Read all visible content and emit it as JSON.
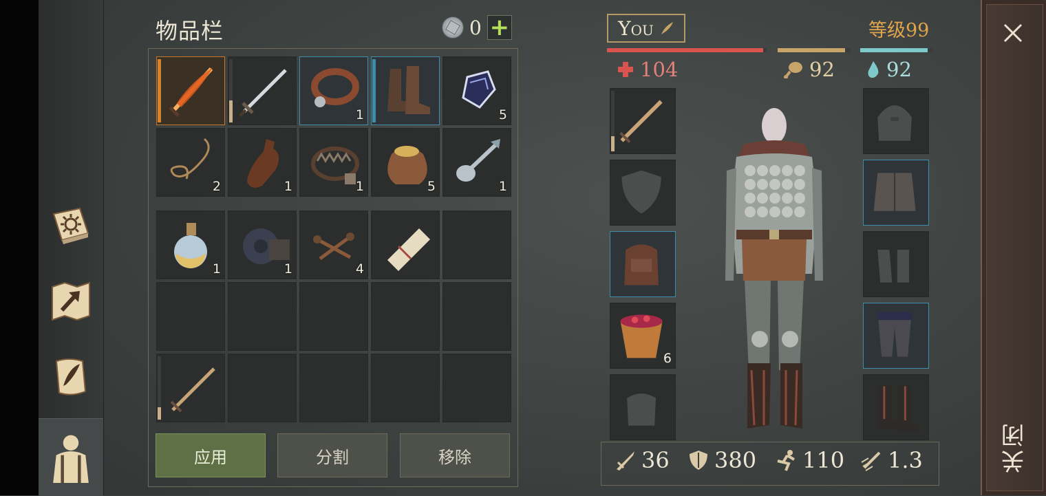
{
  "inventory": {
    "title": "物品栏",
    "currency": "0",
    "row1": [
      {
        "name": "flaming-sword-icon",
        "qty": "",
        "durability": 1.0,
        "dur_color": "#d4832c",
        "highlight": "orange"
      },
      {
        "name": "longsword-icon",
        "qty": "",
        "durability": 0.35,
        "dur_color": "#c9b08a",
        "highlight": ""
      },
      {
        "name": "leather-collar-icon",
        "qty": "1",
        "highlight": "blue"
      },
      {
        "name": "leather-boots-icon",
        "qty": "",
        "durability": 1.0,
        "dur_color": "#3f8ea9",
        "highlight": "blue"
      },
      {
        "name": "dark-crystal-icon",
        "qty": "5",
        "highlight": ""
      }
    ],
    "row2": [
      {
        "name": "rope-icon",
        "qty": "2"
      },
      {
        "name": "leather-flask-icon",
        "qty": "1"
      },
      {
        "name": "bear-trap-icon",
        "qty": "1"
      },
      {
        "name": "grain-sack-icon",
        "qty": "5"
      },
      {
        "name": "spoon-icon",
        "qty": "1"
      }
    ],
    "backpack": [
      {
        "name": "potion-flask-icon",
        "qty": "1"
      },
      {
        "name": "gear-cog-icon",
        "qty": "1"
      },
      {
        "name": "nails-icon",
        "qty": "4"
      },
      {
        "name": "scroll-icon",
        "qty": ""
      },
      {
        "name": "empty-slot",
        "qty": ""
      },
      {
        "name": "empty-slot",
        "qty": ""
      },
      {
        "name": "empty-slot",
        "qty": ""
      },
      {
        "name": "empty-slot",
        "qty": ""
      },
      {
        "name": "empty-slot",
        "qty": ""
      },
      {
        "name": "empty-slot",
        "qty": ""
      },
      {
        "name": "wooden-sword-icon",
        "qty": "",
        "durability": 0.2,
        "dur_color": "#c9b08a"
      },
      {
        "name": "empty-slot",
        "qty": ""
      },
      {
        "name": "empty-slot",
        "qty": ""
      },
      {
        "name": "empty-slot",
        "qty": ""
      },
      {
        "name": "empty-slot",
        "qty": ""
      }
    ],
    "buttons": {
      "apply": "应用",
      "split": "分割",
      "remove": "移除"
    }
  },
  "character": {
    "name": "You",
    "level": "等级99",
    "health": "104",
    "hunger": "92",
    "thirst": "92",
    "health_fraction": 0.98,
    "hunger_fraction": 0.92,
    "thirst_fraction": 0.92,
    "colors": {
      "health": "#d9534f",
      "hunger": "#c7a46a",
      "thirst": "#7ec9c9",
      "level": "#e0a44d"
    },
    "left_slots": [
      {
        "name": "equipped-sword-icon",
        "qty": "",
        "durability": 0.25
      },
      {
        "name": "shield-slot-icon",
        "qty": ""
      },
      {
        "name": "backpack-icon",
        "qty": "",
        "highlight": "blue"
      },
      {
        "name": "berry-bucket-icon",
        "qty": "6"
      },
      {
        "name": "pouch-slot-icon",
        "qty": ""
      }
    ],
    "right_slots": [
      {
        "name": "helmet-slot-icon"
      },
      {
        "name": "chest-armor-icon",
        "highlight": "blue"
      },
      {
        "name": "gloves-slot-icon"
      },
      {
        "name": "leg-armor-icon",
        "highlight": "blue"
      },
      {
        "name": "armored-boots-icon"
      }
    ],
    "stats": {
      "attack": "36",
      "armor": "380",
      "speed": "110",
      "attack_speed": "1.3"
    }
  },
  "close_label": "关闭"
}
